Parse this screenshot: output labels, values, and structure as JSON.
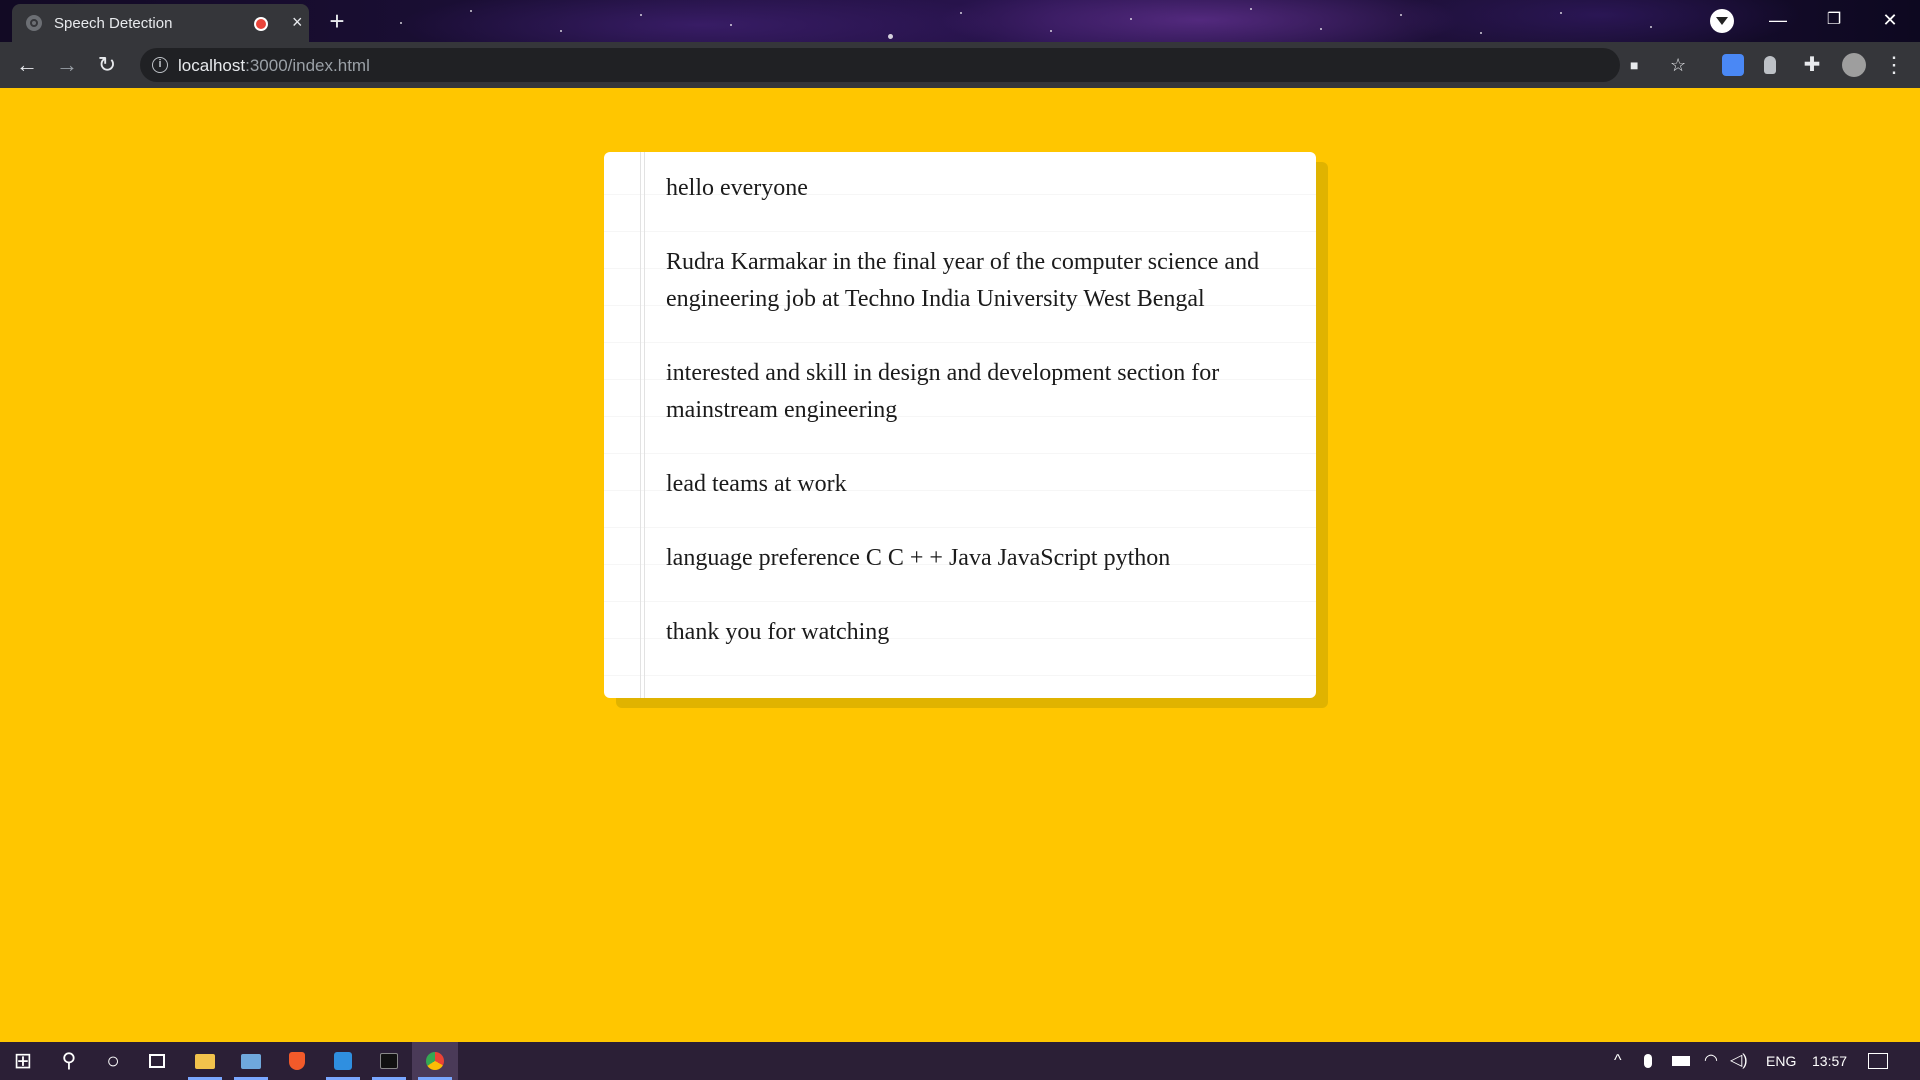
{
  "browser": {
    "tab": {
      "title": "Speech Detection",
      "close_icon": "×"
    },
    "new_tab_icon": "+",
    "window_controls": {
      "minimize": "—",
      "restore": "❐",
      "close": "✕"
    },
    "address": {
      "host": "localhost",
      "path": ":3000/index.html"
    },
    "nav": {
      "back": "←",
      "forward": "→",
      "reload": "↻"
    },
    "toolbar_icons": {
      "camera": "■",
      "bookmark": "☆",
      "menu": "⋮",
      "puzzle": "✚"
    }
  },
  "notes": [
    "hello everyone",
    "Rudra Karmakar in the final year of the computer science and engineering job at Techno India University West Bengal",
    "interested and skill in design and development section for mainstream engineering",
    "lead teams at work",
    "language preference C C + + Java JavaScript python",
    "thank you for watching"
  ],
  "colors": {
    "page_background": "#ffc600",
    "card_background": "#ffffff"
  },
  "taskbar": {
    "start_icon": "⊞",
    "search_icon": "⚲",
    "cortana_icon": "○",
    "language": "ENG",
    "time": "13:57"
  }
}
